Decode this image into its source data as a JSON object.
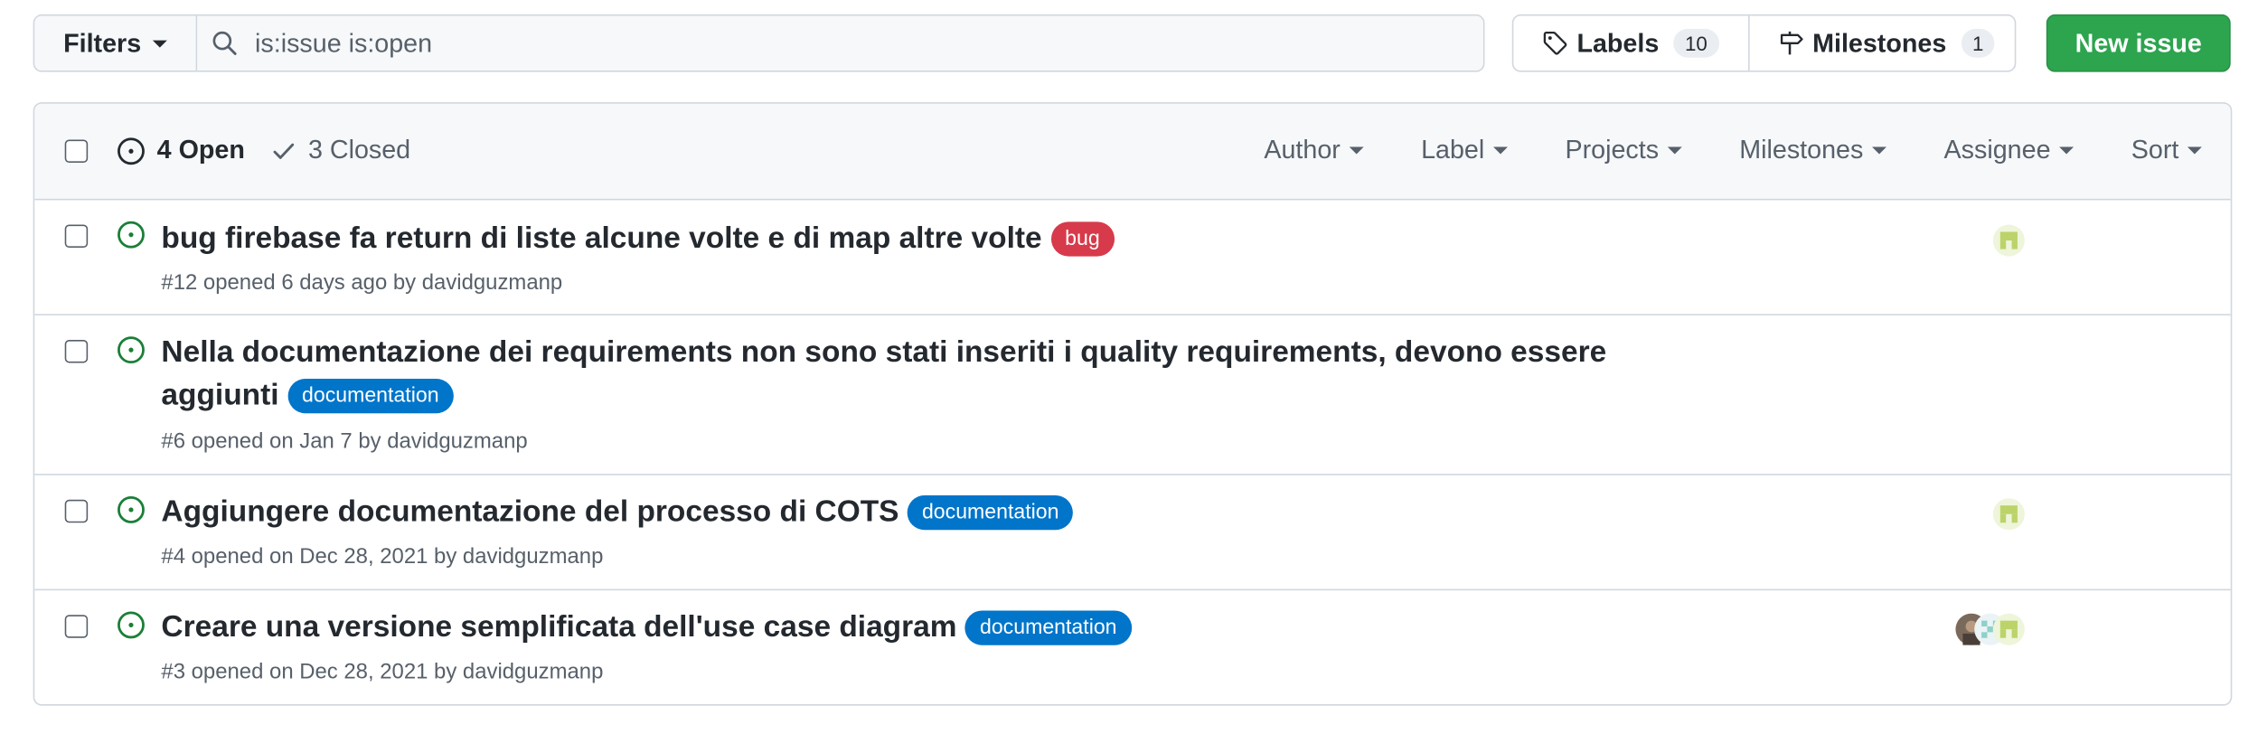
{
  "toolbar": {
    "filters_label": "Filters",
    "search_value": "is:issue is:open",
    "labels_label": "Labels",
    "labels_count": "10",
    "milestones_label": "Milestones",
    "milestones_count": "1",
    "new_issue_label": "New issue"
  },
  "header": {
    "open_label": "4 Open",
    "closed_label": "3 Closed",
    "filters": [
      "Author",
      "Label",
      "Projects",
      "Milestones",
      "Assignee",
      "Sort"
    ]
  },
  "issues": [
    {
      "title": "bug firebase fa return di liste alcune volte e di map altre volte",
      "title_line2": "",
      "label": "bug",
      "label_color": "#d73a4a",
      "meta": "#12 opened 6 days ago by ",
      "author": "davidguzmanp"
    },
    {
      "title": "Nella documentazione dei requirements non sono stati inseriti i quality requirements, devono essere",
      "title_line2": "aggiunti",
      "label": "documentation",
      "label_color": "#0075ca",
      "meta": "#6 opened on Jan 7 by ",
      "author": "davidguzmanp"
    },
    {
      "title": "Aggiungere documentazione del processo di COTS",
      "title_line2": "",
      "label": "documentation",
      "label_color": "#0075ca",
      "meta": "#4 opened on Dec 28, 2021 by ",
      "author": "davidguzmanp"
    },
    {
      "title": "Creare una versione semplificata dell'use case diagram",
      "title_line2": "",
      "label": "documentation",
      "label_color": "#0075ca",
      "meta": "#3 opened on Dec 28, 2021 by ",
      "author": "davidguzmanp"
    }
  ],
  "colors": {
    "open_icon": "#1a7f37",
    "primary_button": "#2da44e",
    "border": "#d0d7de"
  }
}
